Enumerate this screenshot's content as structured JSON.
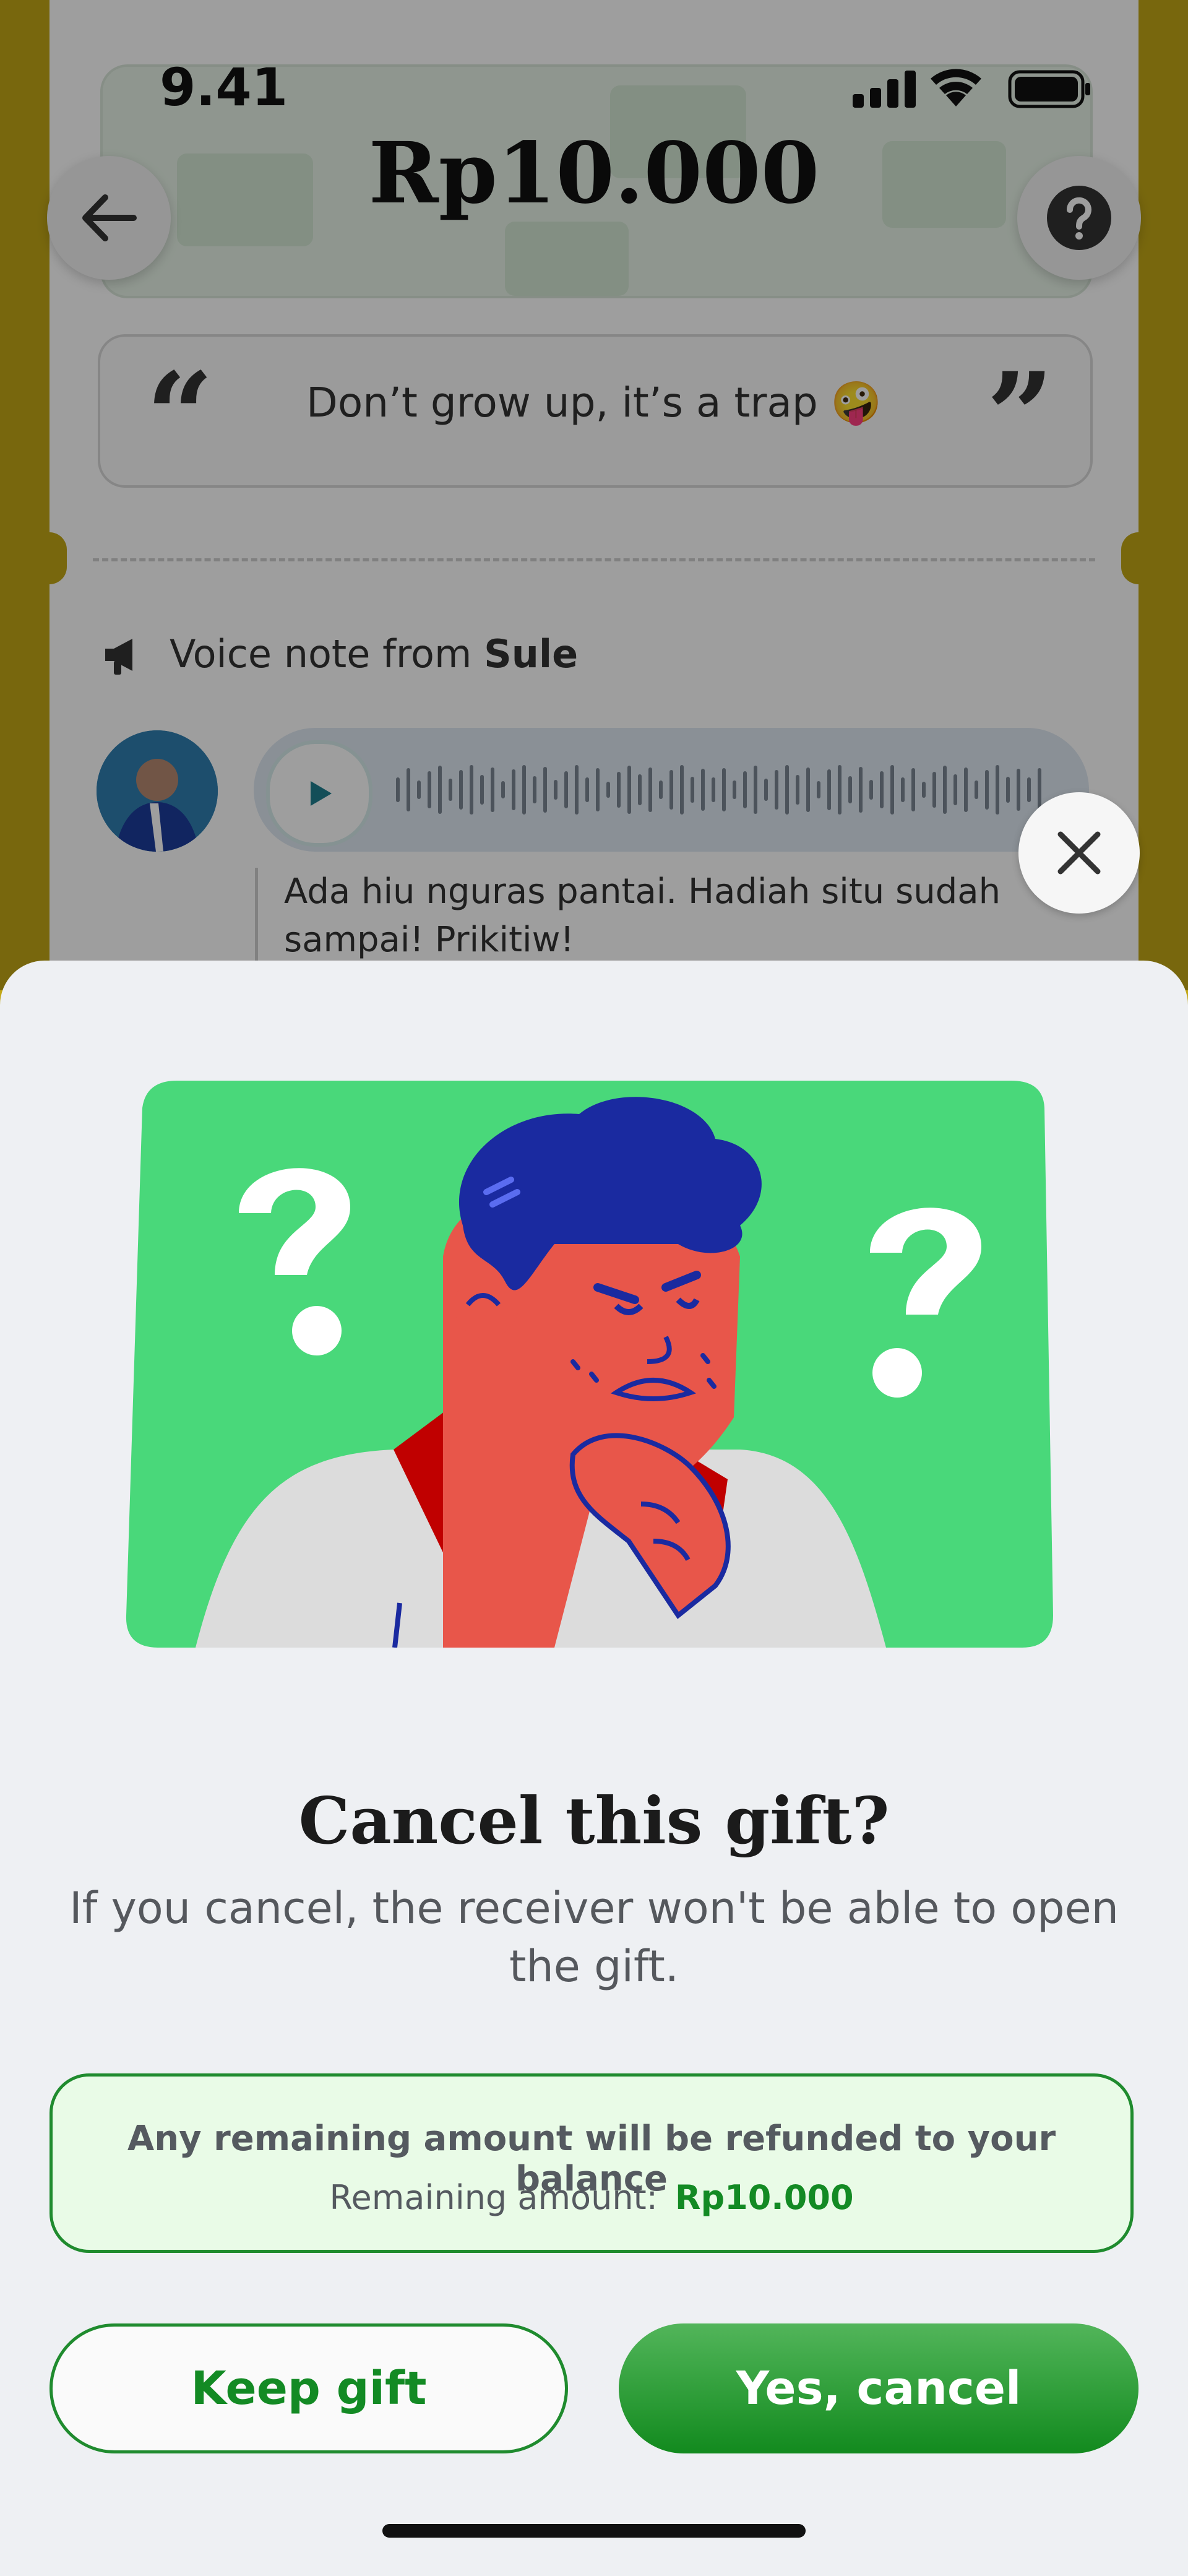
{
  "status_bar": {
    "time": "9.41"
  },
  "gift": {
    "amount": "Rp10.000",
    "message": "Don’t grow up, it’s a trap 🤪",
    "voice_note_prefix": "Voice note from",
    "voice_note_sender": "Sule",
    "voice_caption": "Ada hiu nguras pantai. Hadiah situ sudah sampai! Prikitiw!"
  },
  "icons": {
    "back": "arrow-left-icon",
    "help": "question-icon",
    "close": "close-icon",
    "play": "play-icon",
    "speaker": "megaphone-icon"
  },
  "sheet": {
    "title": "Cancel this gift?",
    "subtitle": "If you cancel, the receiver won't be able to open the gift.",
    "info_title": "Any remaining amount will be refunded to your balance",
    "remaining_label": "Remaining amount:",
    "remaining_value": "Rp10.000",
    "keep_label": "Keep gift",
    "cancel_label": "Yes, cancel"
  },
  "colors": {
    "brand_green": "#138a24",
    "sheet_bg": "#eef0f3",
    "frame_yellow": "#c2a716",
    "illustration_green": "#49d87a"
  }
}
